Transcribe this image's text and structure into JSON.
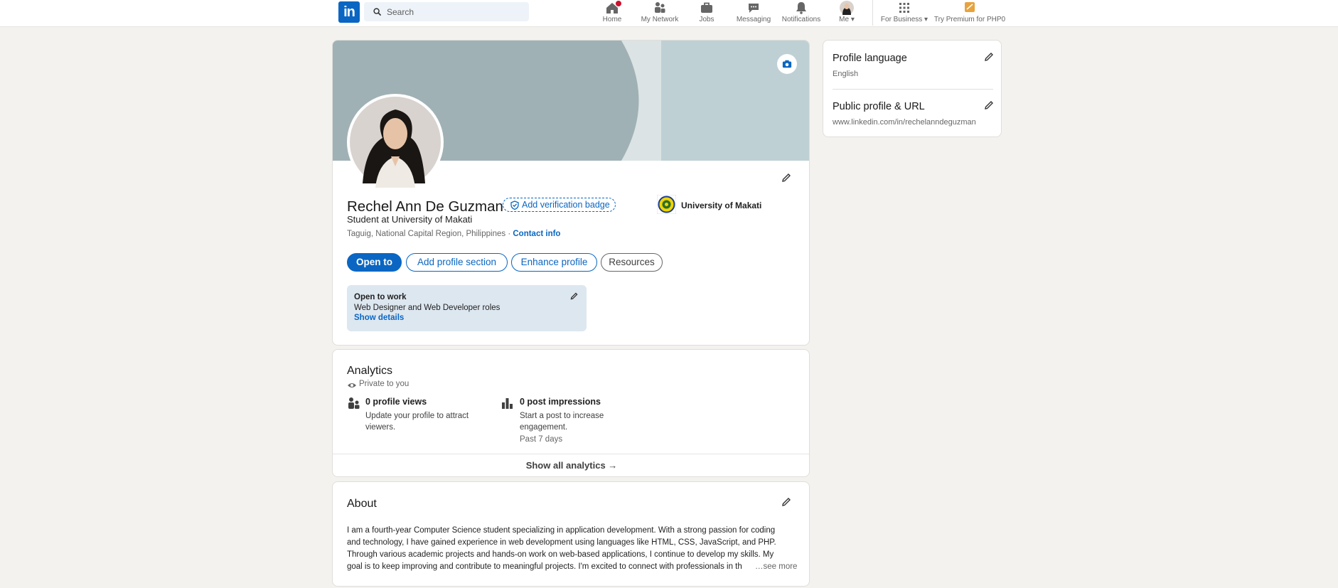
{
  "nav": {
    "logo_text": "in",
    "search_placeholder": "Search",
    "items": [
      {
        "label": "Home"
      },
      {
        "label": "My Network"
      },
      {
        "label": "Jobs"
      },
      {
        "label": "Messaging"
      },
      {
        "label": "Notifications"
      },
      {
        "label": "Me"
      },
      {
        "label": "For Business"
      },
      {
        "label": "Try Premium for PHP0"
      }
    ]
  },
  "profile": {
    "name": "Rechel Ann De Guzman",
    "verify_badge_label": "Add verification badge",
    "headline": "Student at University of Makati",
    "location": "Taguig, National Capital Region, Philippines",
    "separator": "·",
    "contact_info_label": "Contact info",
    "education": "University of Makati",
    "buttons": {
      "open_to": "Open to",
      "add_section": "Add profile section",
      "enhance": "Enhance profile",
      "resources": "Resources"
    },
    "open_to_work": {
      "title": "Open to work",
      "roles": "Web Designer and Web Developer roles",
      "show_details": "Show details"
    }
  },
  "analytics": {
    "title": "Analytics",
    "privacy": "Private to you",
    "profile_views_title": "0 profile views",
    "profile_views_desc_1": "Update your profile to attract",
    "profile_views_desc_2": "viewers.",
    "impressions_title": "0 post impressions",
    "impressions_desc_1": "Start a post to increase",
    "impressions_desc_2": "engagement.",
    "impressions_period": "Past 7 days",
    "show_all": "Show all analytics →"
  },
  "about": {
    "title": "About",
    "lines": [
      "I am a fourth-year Computer Science student specializing in application development. With a strong passion for coding",
      "and technology, I have gained experience in web development using languages like HTML, CSS, JavaScript, and PHP.",
      "Through various academic projects and hands-on work on web-based applications, I continue to develop my skills. My",
      "goal is to keep improving and contribute to meaningful projects. I'm excited to connect with professionals in th"
    ],
    "see_more": "…see more"
  },
  "sidebar": {
    "language_title": "Profile language",
    "language_value": "English",
    "url_title": "Public profile & URL",
    "url_value": "www.linkedin.com/in/rechelanndeguzman"
  },
  "colors": {
    "brand_blue": "#0a66c2",
    "page_bg": "#f4f2ee",
    "banner_dark": "#a0b1b5",
    "banner_light": "#bfd0d4",
    "open_to_work_bg": "#dde7f0",
    "badge_red": "#cb112d"
  }
}
